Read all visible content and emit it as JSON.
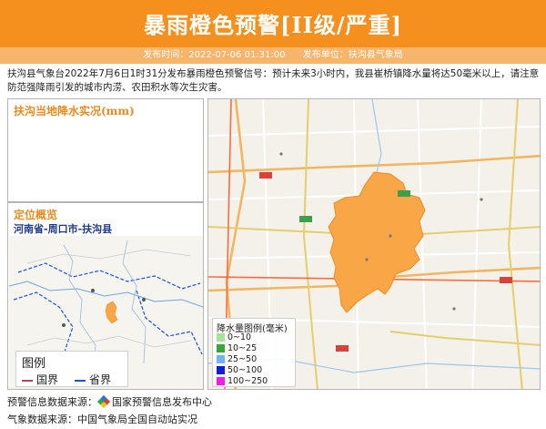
{
  "header": {
    "title": "暴雨橙色预警[II级/严重]",
    "publish_time": "发布时间：2022-07-06 01:31:00",
    "publisher": "发布单位：扶沟县气象局"
  },
  "notice": {
    "text": "扶沟县气象台2022年7月6日1时31分发布暴雨橙色预警信号：预计未来3小时内，我县崔桥镇降水量将达50毫米以上，请注意防范强降雨引发的城市内涝、农田积水等次生灾害。"
  },
  "rain_panel": {
    "title": "扶沟当地降水实况(mm)"
  },
  "locate_panel": {
    "title": "定位概览",
    "region": "河南省-周口市-扶沟县",
    "legend_title": "图例",
    "legend_items": [
      {
        "label": "国界",
        "color": "#b5485e"
      },
      {
        "label": "省界",
        "color": "#1e4fd8"
      }
    ]
  },
  "rain_legend": {
    "title": "降水量图例(毫米)",
    "items": [
      {
        "label": "0~10",
        "color": "#a6e39a"
      },
      {
        "label": "10~25",
        "color": "#3aa53a"
      },
      {
        "label": "25~50",
        "color": "#6fb4f5"
      },
      {
        "label": "50~100",
        "color": "#0b1fd8"
      },
      {
        "label": "100~250",
        "color": "#ee1ee8"
      }
    ]
  },
  "colors": {
    "header": "#f5901f",
    "county_fill": "#f9a646",
    "title_accent": "#e98b1f"
  },
  "footer": {
    "source_label": "预警信息数据来源：",
    "source_name": "国家预警信息发布中心",
    "weather": "气象数据来源：中国气象局全国自动站实况"
  }
}
